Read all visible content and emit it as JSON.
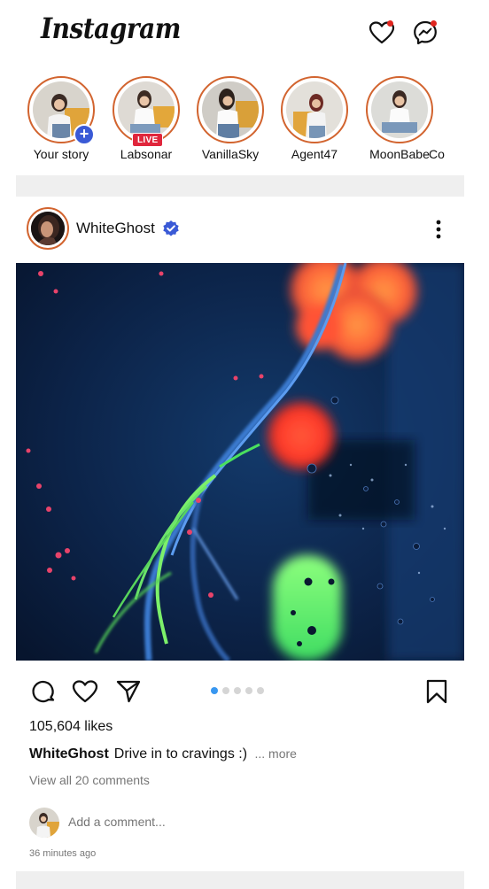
{
  "app": {
    "logo_text": "Instagram"
  },
  "header": {
    "icons": [
      "heart-icon",
      "messenger-icon"
    ],
    "notification_color": "#e0261f"
  },
  "stories": [
    {
      "name": "Your story",
      "badge": "plus"
    },
    {
      "name": "Labsonar",
      "badge": "LIVE"
    },
    {
      "name": "VanillaSky",
      "badge": ""
    },
    {
      "name": "Agent47",
      "badge": ""
    },
    {
      "name": "MoonBabe",
      "badge": ""
    },
    {
      "name": "Co",
      "badge": ""
    }
  ],
  "post": {
    "username": "WhiteGhost",
    "verified": true,
    "likes": "105,604 likes",
    "caption_user": "WhiteGhost",
    "caption_text": "Drive in to cravings :)",
    "caption_more": "... more",
    "view_comments": "View all 20 comments",
    "comment_placeholder": "Add a comment...",
    "timestamp": "36 minutes ago",
    "carousel": {
      "count": 5,
      "active_index": 0
    }
  },
  "colors": {
    "story_ring": "#d2642f",
    "verified_badge": "#3a5ad6",
    "live_badge": "#e0263c",
    "active_dot": "#3897f0"
  }
}
